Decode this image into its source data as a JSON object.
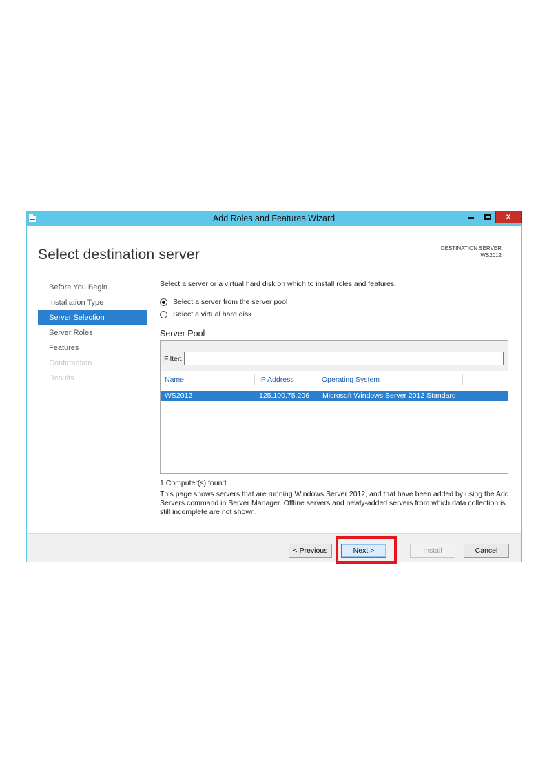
{
  "window": {
    "title": "Add Roles and Features Wizard",
    "close_label": "x"
  },
  "header": {
    "page_title": "Select destination server",
    "destination_label": "DESTINATION SERVER",
    "destination_value": "WS2012"
  },
  "nav": {
    "items": [
      {
        "label": "Before You Begin",
        "state": "normal"
      },
      {
        "label": "Installation Type",
        "state": "normal"
      },
      {
        "label": "Server Selection",
        "state": "active"
      },
      {
        "label": "Server Roles",
        "state": "normal"
      },
      {
        "label": "Features",
        "state": "normal"
      },
      {
        "label": "Confirmation",
        "state": "disabled"
      },
      {
        "label": "Results",
        "state": "disabled"
      }
    ]
  },
  "content": {
    "instruction": "Select a server or a virtual hard disk on which to install roles and features.",
    "radio_options": [
      {
        "label": "Select a server from the server pool",
        "checked": true
      },
      {
        "label": "Select a virtual hard disk",
        "checked": false
      }
    ],
    "pool_title": "Server Pool",
    "filter_label": "Filter:",
    "filter_value": "",
    "columns": [
      "Name",
      "IP Address",
      "Operating System"
    ],
    "rows": [
      {
        "name": "WS2012",
        "ip": "125.100.75.206",
        "os": "Microsoft Windows Server 2012 Standard",
        "selected": true
      }
    ],
    "found_text": "1 Computer(s) found",
    "description": "This page shows servers that are running Windows Server 2012, and that have been added by using the Add Servers command in Server Manager. Offline servers and newly-added servers from which data collection is still incomplete are not shown."
  },
  "footer": {
    "previous_label": "< Previous",
    "next_label": "Next >",
    "install_label": "Install",
    "cancel_label": "Cancel"
  },
  "colors": {
    "titlebar": "#5ec7ea",
    "selection": "#2b7fcf",
    "highlight": "#e3161e",
    "close_button": "#c7302a"
  }
}
